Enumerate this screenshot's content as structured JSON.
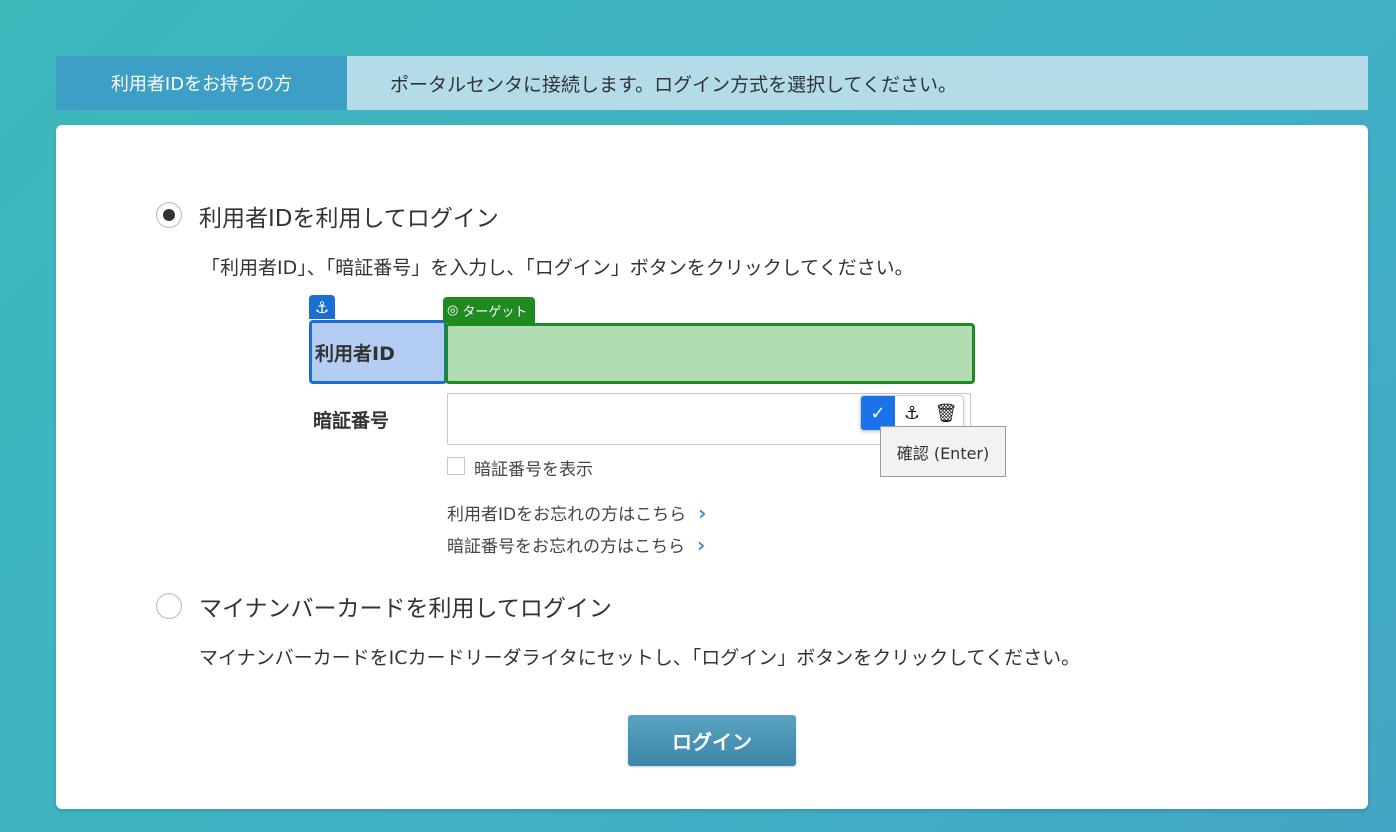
{
  "header": {
    "tab_label": "利用者IDをお持ちの方",
    "message": "ポータルセンタに接続します。ログイン方式を選択してください。"
  },
  "option_id": {
    "title": "利用者IDを利用してログイン",
    "description": "「利用者ID」、「暗証番号」を入力し、「ログイン」ボタンをクリックしてください。",
    "selected": true,
    "user_id_label": "利用者ID",
    "user_id_value": "",
    "pin_label": "暗証番号",
    "pin_value": "",
    "show_pin_label": "暗証番号を表示",
    "forgot_id_link": "利用者IDをお忘れの方はこちら",
    "forgot_pin_link": "暗証番号をお忘れの方はこちら"
  },
  "option_card": {
    "title": "マイナンバーカードを利用してログイン",
    "description": "マイナンバーカードをICカードリーダライタにセットし、「ログイン」ボタンをクリックしてください。",
    "selected": false
  },
  "login_button_label": "ログイン",
  "overlay": {
    "anchor_icon": "⚓",
    "target_tag_label": "ターゲット",
    "target_icon": "◎",
    "toolbar_confirm_icon": "✓",
    "toolbar_anchor_icon": "⚓",
    "toolbar_delete_icon": "🗑",
    "tooltip_text": "確認 (Enter)"
  },
  "colors": {
    "background_start": "#3db8bb",
    "header_tab": "#3d9ec6",
    "header_bar": "#b3dce8",
    "login_button": "#4a95b8",
    "anchor_blue": "#1a6fd0",
    "target_green": "#1f8a1f"
  }
}
